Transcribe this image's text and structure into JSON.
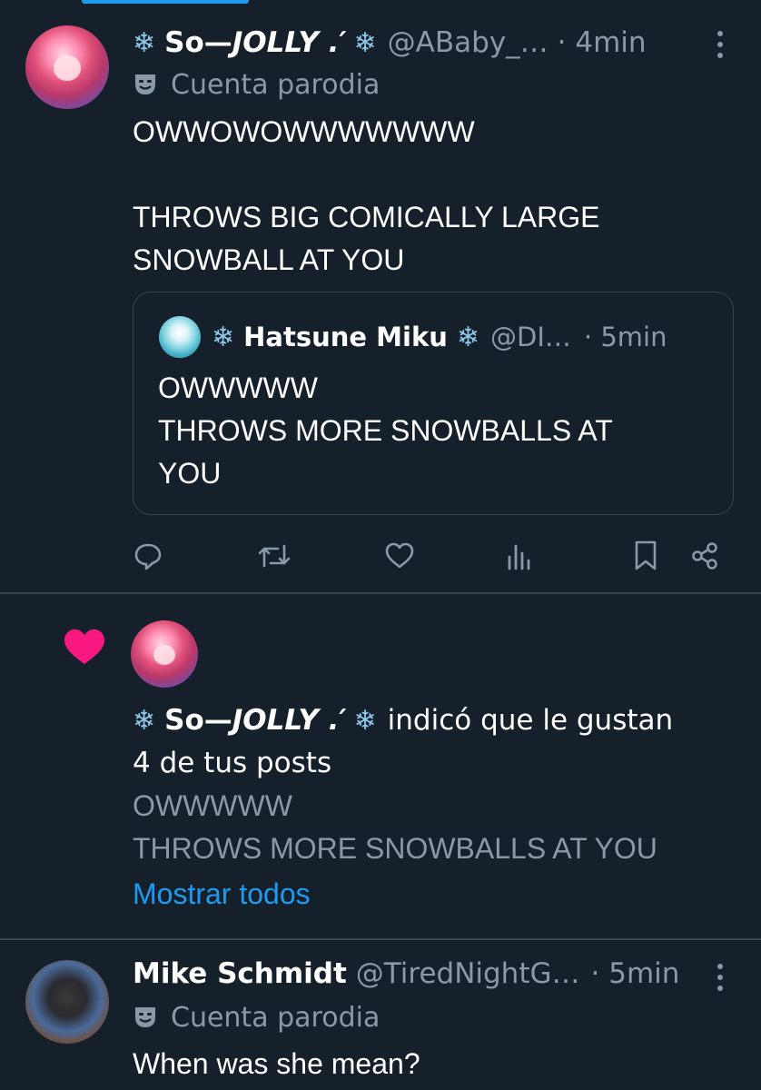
{
  "post1": {
    "display_name_a": "So—",
    "display_name_b": "JOLLY .′",
    "handle": "@ABaby_…",
    "time": "· 4min",
    "parody_label": "Cuenta parodia",
    "body": "OWWOWOWWWWWWW\n\nTHROWS BIG COMICALLY LARGE\nSNOWBALL AT YOU",
    "quote": {
      "display_name": "Hatsune Miku",
      "handle": "@DI…",
      "time": "· 5min",
      "body": "OWWWWW\nTHROWS MORE SNOWBALLS AT\nYOU"
    },
    "icons": [
      "reply-icon",
      "repost-icon",
      "like-icon",
      "views-icon",
      "bookmark-icon",
      "share-icon"
    ]
  },
  "notification": {
    "display_name_a": "So—",
    "display_name_b": "JOLLY .′",
    "action_text": "indicó que le gustan",
    "count_text": "4 de tus posts",
    "preview": "OWWWWW\nTHROWS MORE SNOWBALLS AT YOU",
    "show_all": "Mostrar todos",
    "heart_color": "#f91880"
  },
  "post2": {
    "display_name": "Mike Schmidt",
    "handle": "@TiredNightG…",
    "time": "· 5min",
    "parody_label": "Cuenta parodia",
    "body": "When was she mean?"
  },
  "colors": {
    "background": "#15202b",
    "muted": "#8b98a5",
    "accent": "#1d9bf0",
    "border": "#38444d"
  }
}
